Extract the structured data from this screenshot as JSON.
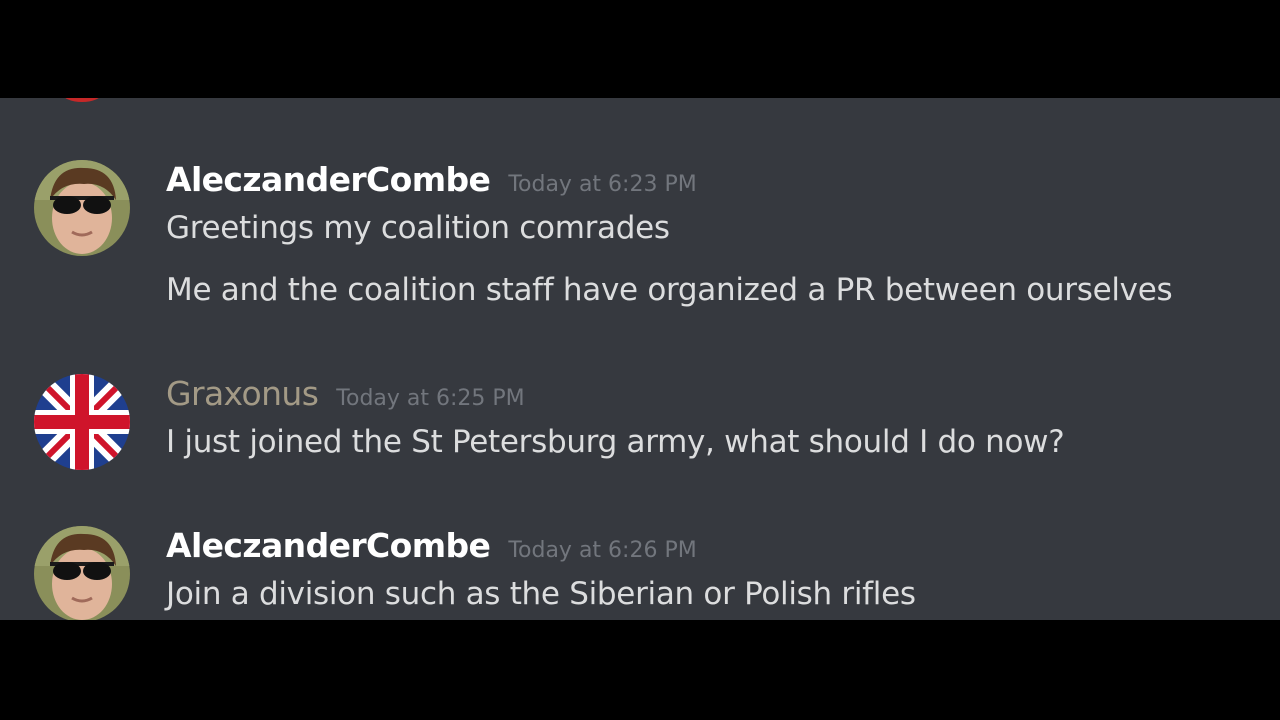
{
  "messages": [
    {
      "author": "AleczanderCombe",
      "timestamp": "Today at 6:23 PM",
      "avatar_icon": "sunglasses-man-avatar",
      "lines": [
        "Greetings my coalition comrades",
        "Me and the coalition staff have organized a PR between ourselves"
      ]
    },
    {
      "author": "Graxonus",
      "timestamp": "Today at 6:25 PM",
      "avatar_icon": "union-jack-avatar",
      "lines": [
        "I just joined the St Petersburg army, what should I do now?"
      ]
    },
    {
      "author": "AleczanderCombe",
      "timestamp": "Today at 6:26 PM",
      "avatar_icon": "sunglasses-man-avatar",
      "lines": [
        "Join a division such as the Siberian or Polish rifles"
      ]
    }
  ],
  "colors": {
    "background": "#36393f",
    "letterbox": "#000000",
    "username_default": "#ffffff",
    "username_graxonus": "#a39a86",
    "timestamp": "#72767d",
    "message_text": "#dcddde"
  }
}
